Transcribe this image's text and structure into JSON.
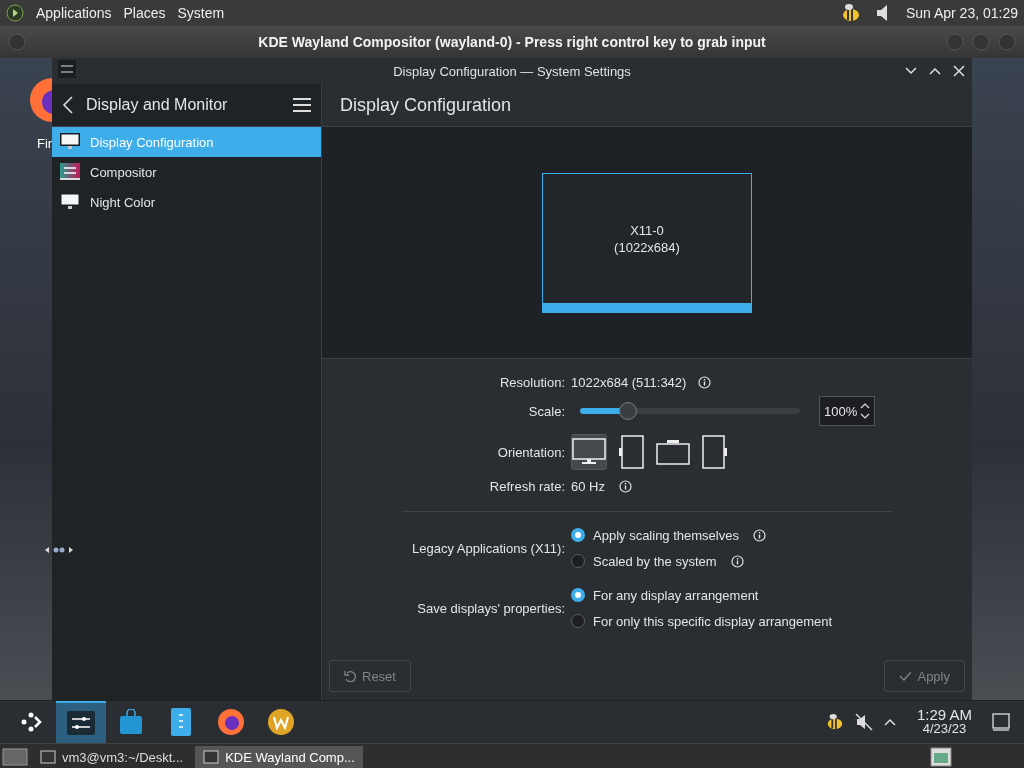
{
  "top_panel": {
    "menus": [
      "Applications",
      "Places",
      "System"
    ],
    "clock": "Sun Apr 23, 01:29"
  },
  "host_window": {
    "title": "KDE Wayland Compositor (wayland-0) - Press right control key to grab input"
  },
  "desktop": {
    "icon_label": "Fir"
  },
  "window": {
    "title": "Display Configuration — System Settings"
  },
  "sidebar": {
    "header": "Display and Monitor",
    "items": [
      {
        "label": "Display Configuration",
        "kind": "monitor",
        "selected": true
      },
      {
        "label": "Compositor",
        "kind": "compositor",
        "selected": false
      },
      {
        "label": "Night Color",
        "kind": "monitor",
        "selected": false
      }
    ]
  },
  "page": {
    "title": "Display Configuration",
    "output": {
      "name": "X11-0",
      "size": "(1022x684)"
    },
    "resolution": {
      "label": "Resolution:",
      "value": "1022x684 (511:342)"
    },
    "scale": {
      "label": "Scale:",
      "level": 0.22,
      "value": "100%"
    },
    "orientation": {
      "label": "Orientation:",
      "options": [
        {
          "kind": "normal",
          "selected": true
        },
        {
          "kind": "left",
          "selected": false
        },
        {
          "kind": "inverted",
          "selected": false
        },
        {
          "kind": "right",
          "selected": false
        }
      ]
    },
    "refresh_rate": {
      "label": "Refresh rate:",
      "value": "60 Hz"
    },
    "legacy_apps": {
      "label": "Legacy Applications (X11):",
      "options": [
        {
          "label": "Apply scaling themselves",
          "selected": true
        },
        {
          "label": "Scaled by the system",
          "selected": false
        }
      ]
    },
    "save_properties": {
      "label": "Save displays' properties:",
      "options": [
        {
          "label": "For any display arrangement",
          "selected": true
        },
        {
          "label": "For only this specific display arrangement",
          "selected": false
        }
      ]
    },
    "buttons": [
      {
        "label": "Reset",
        "kind": "reset",
        "disabled": true
      },
      {
        "label": "Apply",
        "kind": "apply",
        "disabled": true
      }
    ]
  },
  "panel": {
    "launchers": [
      {
        "kind": "settings",
        "active": true
      },
      {
        "kind": "store",
        "active": false
      },
      {
        "kind": "files",
        "active": false
      },
      {
        "kind": "firefox",
        "active": false
      },
      {
        "kind": "w",
        "active": false
      }
    ],
    "time": "1:29 AM",
    "date": "4/23/23"
  },
  "taskbar": {
    "tasks": [
      {
        "label": "vm3@vm3:~/Deskt...",
        "selected": false
      },
      {
        "label": "KDE Wayland Comp...",
        "selected": true
      }
    ]
  }
}
